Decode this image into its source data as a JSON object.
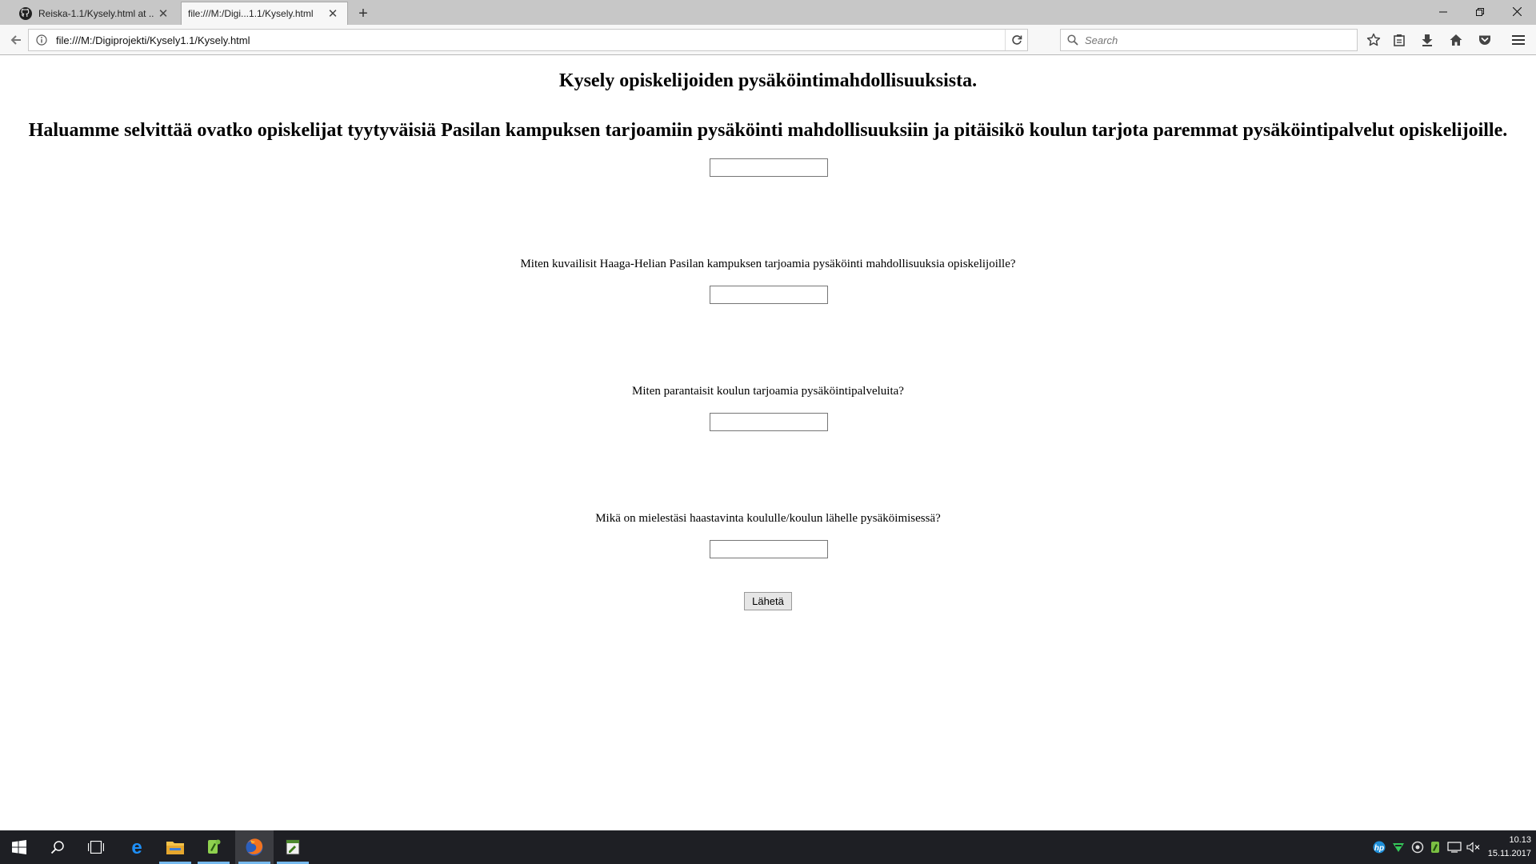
{
  "browser": {
    "tabs": [
      {
        "title": "Reiska-1.1/Kysely.html at ...",
        "icon": "github-icon",
        "active": false
      },
      {
        "title": "file:///M:/Digi...1.1/Kysely.html",
        "icon": "none",
        "active": true
      }
    ],
    "address": "file:///M:/Digiprojekti/Kysely1.1/Kysely.html",
    "search_placeholder": "Search"
  },
  "page": {
    "heading": "Kysely opiskelijoiden pysäköintimahdollisuuksista.",
    "intro": "Haluamme selvittää ovatko opiskelijat tyytyväisiä Pasilan kampuksen tarjoamiin pysäköinti mahdollisuuksiin ja pitäisikö koulun tarjota paremmat pysäköintipalvelut opiskelijoille.",
    "questions": [
      {
        "label": "",
        "value": ""
      },
      {
        "label": "Miten kuvailisit Haaga-Helian Pasilan kampuksen tarjoamia pysäköinti mahdollisuuksia opiskelijoille?",
        "value": ""
      },
      {
        "label": "Miten parantaisit koulun tarjoamia pysäköintipalveluita?",
        "value": ""
      },
      {
        "label": "Mikä on mielestäsi haastavinta koululle/koulun lähelle pysäköimisessä?",
        "value": ""
      }
    ],
    "submit_label": "Lähetä"
  },
  "taskbar": {
    "apps": [
      "windows-start-icon",
      "search-icon",
      "task-view-icon",
      "edge-icon",
      "file-explorer-icon",
      "notepadpp-icon",
      "firefox-icon",
      "editor-icon"
    ],
    "tray": [
      "hp-icon",
      "greenshot-icon",
      "tray-app-icon",
      "notepadpp-tray-icon",
      "network-icon",
      "volume-muted-icon"
    ],
    "time": "10.13",
    "date": "15.11.2017"
  }
}
